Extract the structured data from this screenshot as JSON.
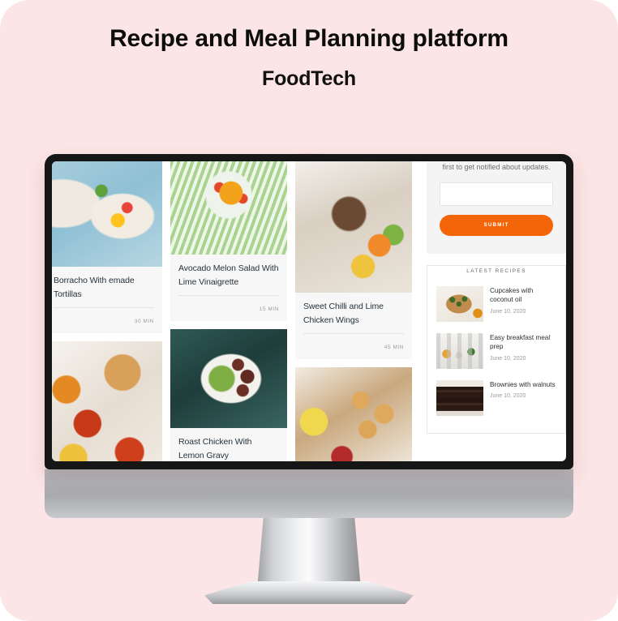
{
  "header": {
    "title": "Recipe and Meal Planning platform",
    "subtitle": "FoodTech"
  },
  "colors": {
    "page_background": "#fce5e6",
    "circle": "#f8d4d8",
    "accent_orange": "#f4650a",
    "bezel": "#161616",
    "chin": "#a9aaae"
  },
  "screen": {
    "recipe_cards": [
      {
        "title": "Borracho With emade Tortillas",
        "time": "30 MIN",
        "image": "ph-eggs",
        "photo_height": 130,
        "has_body": true
      },
      {
        "title": "",
        "time": "",
        "image": "ph-bowls",
        "photo_height": 175,
        "has_body": false
      },
      {
        "title": "Avocado Melon Salad With Lime Vinaigrette",
        "time": "15 MIN",
        "image": "ph-soup",
        "photo_height": 115,
        "has_body": true
      },
      {
        "title": "Roast Chicken With Lemon Gravy",
        "time": "",
        "image": "ph-steak",
        "photo_height": 122,
        "has_body": true
      },
      {
        "title": "Sweet Chilli and Lime Chicken Wings",
        "time": "45 MIN",
        "image": "ph-grain",
        "photo_height": 162,
        "has_body": true
      },
      {
        "title": "",
        "time": "",
        "image": "ph-pastry",
        "photo_height": 120,
        "has_body": false
      }
    ],
    "newsletter": {
      "text": "first to get notified about updates.",
      "input_value": "",
      "input_placeholder": "",
      "submit_label": "SUBMIT"
    },
    "latest": {
      "heading": "LATEST RECIPES",
      "items": [
        {
          "title": "Cupcakes with coconut oil",
          "date": "June 10, 2020",
          "image": "ph-cupcake"
        },
        {
          "title": "Easy breakfast meal prep",
          "date": "June 10, 2020",
          "image": "ph-jars"
        },
        {
          "title": "Brownies with walnuts",
          "date": "June 10, 2020",
          "image": "ph-brownie"
        }
      ]
    }
  }
}
